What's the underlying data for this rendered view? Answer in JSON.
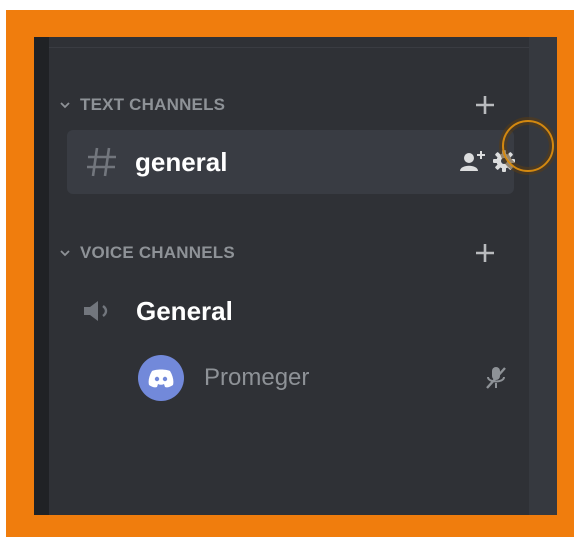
{
  "sidebar": {
    "text_category": {
      "label": "TEXT CHANNELS",
      "add_icon": "plus-icon",
      "collapse_icon": "chevron-down-icon"
    },
    "text_channels": [
      {
        "name": "general",
        "icon": "hash-icon",
        "actions": [
          "add-member-icon",
          "gear-icon"
        ],
        "selected": true
      }
    ],
    "voice_category": {
      "label": "VOICE CHANNELS",
      "add_icon": "plus-icon",
      "collapse_icon": "chevron-down-icon"
    },
    "voice_channels": [
      {
        "name": "General",
        "icon": "speaker-icon",
        "users": [
          {
            "name": "Promeger",
            "avatar_icon": "discord-logo-icon",
            "status_icon": "muted-mic-icon"
          }
        ]
      }
    ]
  },
  "colors": {
    "border": "#f07d0d",
    "panel_bg": "#2f3136",
    "selected_row": "#393c43",
    "muted_text": "#8e9297",
    "text": "#ffffff",
    "avatar": "#7289da",
    "cursor_ring": "#d3880f"
  }
}
